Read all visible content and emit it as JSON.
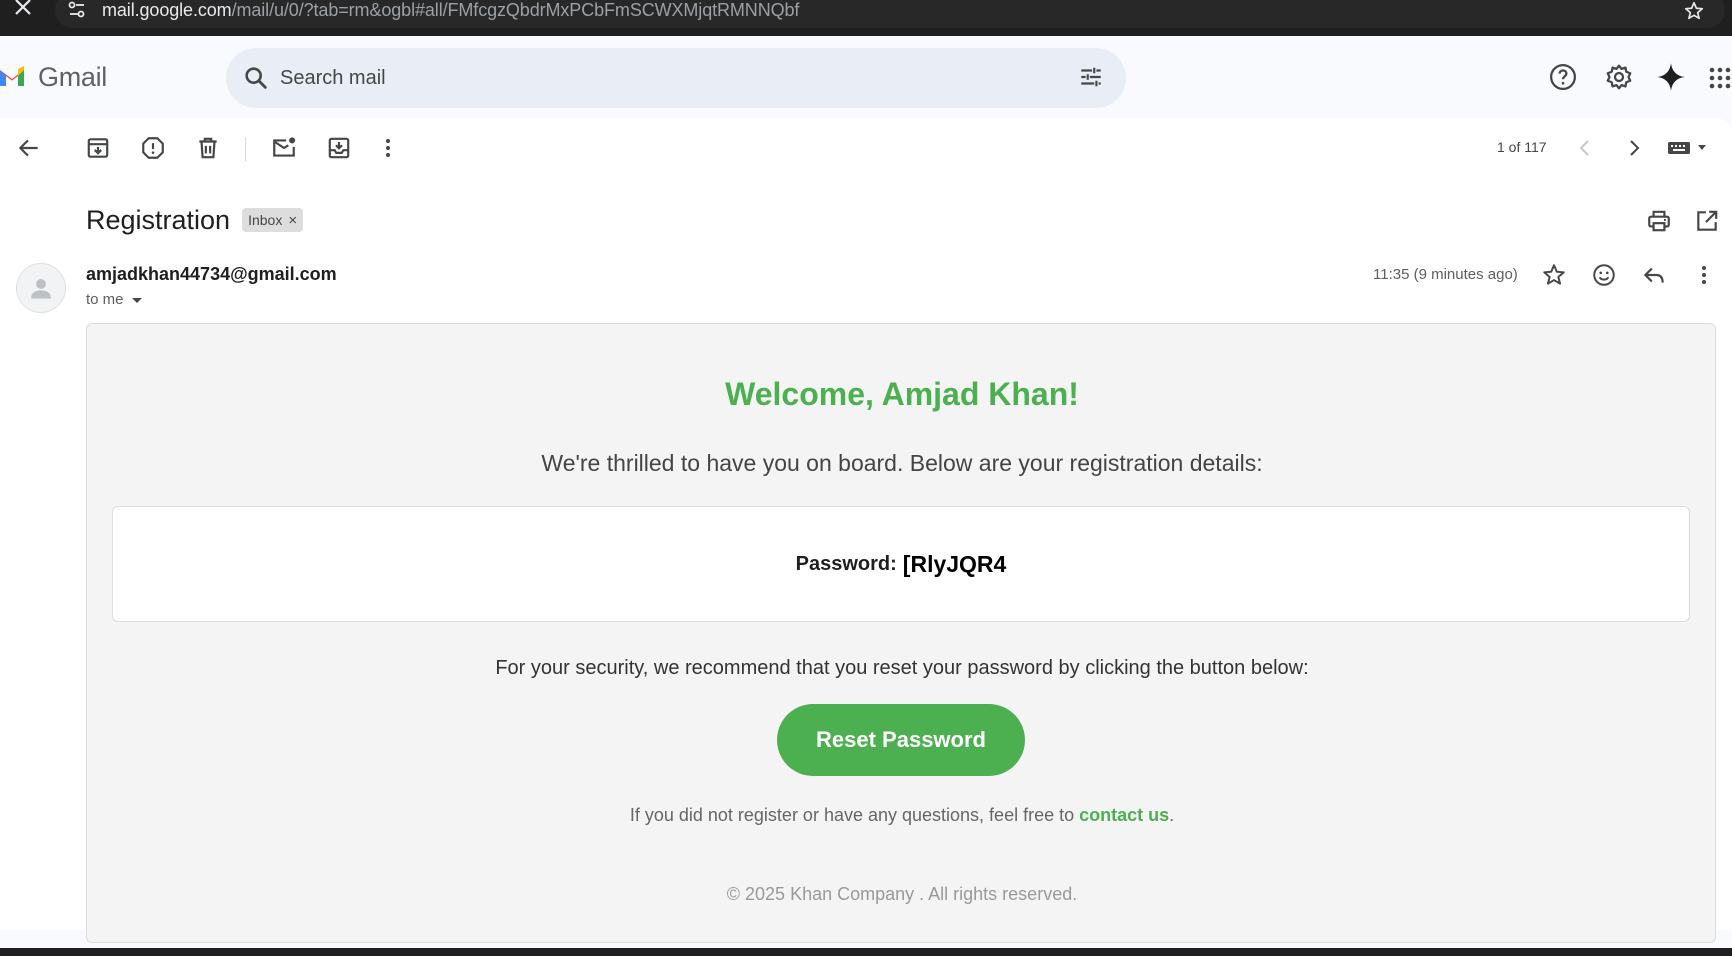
{
  "browser": {
    "url_host": "mail.google.com",
    "url_path": "/mail/u/0/?tab=rm&ogbl#all/FMfcgzQbdrMxPCbFmSCWXMjqtRMNNQbf"
  },
  "header": {
    "app_name": "Gmail",
    "search_placeholder": "Search mail",
    "icons": [
      "help-icon",
      "settings-icon",
      "gemini-sparkle-icon",
      "apps-grid-icon"
    ]
  },
  "toolbar": {
    "icons": [
      "back-arrow-icon",
      "archive-icon",
      "report-spam-icon",
      "delete-icon",
      "mark-unread-icon",
      "move-to-icon",
      "more-vert-icon"
    ],
    "pager_text": "1 of 117"
  },
  "email": {
    "subject": "Registration",
    "label": "Inbox",
    "label_remove": "×",
    "sender": "amjadkhan44734@gmail.com",
    "recipient": "to me",
    "time": "11:35 (9 minutes ago)"
  },
  "body": {
    "welcome": "Welcome, Amjad Khan!",
    "intro": "We're thrilled to have you on board. Below are your registration details:",
    "password_label": "Password:",
    "password_value": "[RlyJQR4",
    "security_note": "For your security, we recommend that you reset your password by clicking the button below:",
    "reset_button": "Reset Password",
    "contact_prefix": "If you did not register or have any questions, feel free to ",
    "contact_link": "contact us",
    "contact_suffix": ".",
    "copyright": "© 2025 Khan Company . All rights reserved."
  },
  "colors": {
    "accent_green": "#4caf50",
    "search_bg": "#e9eef6",
    "page_bg": "#f8fafd"
  }
}
